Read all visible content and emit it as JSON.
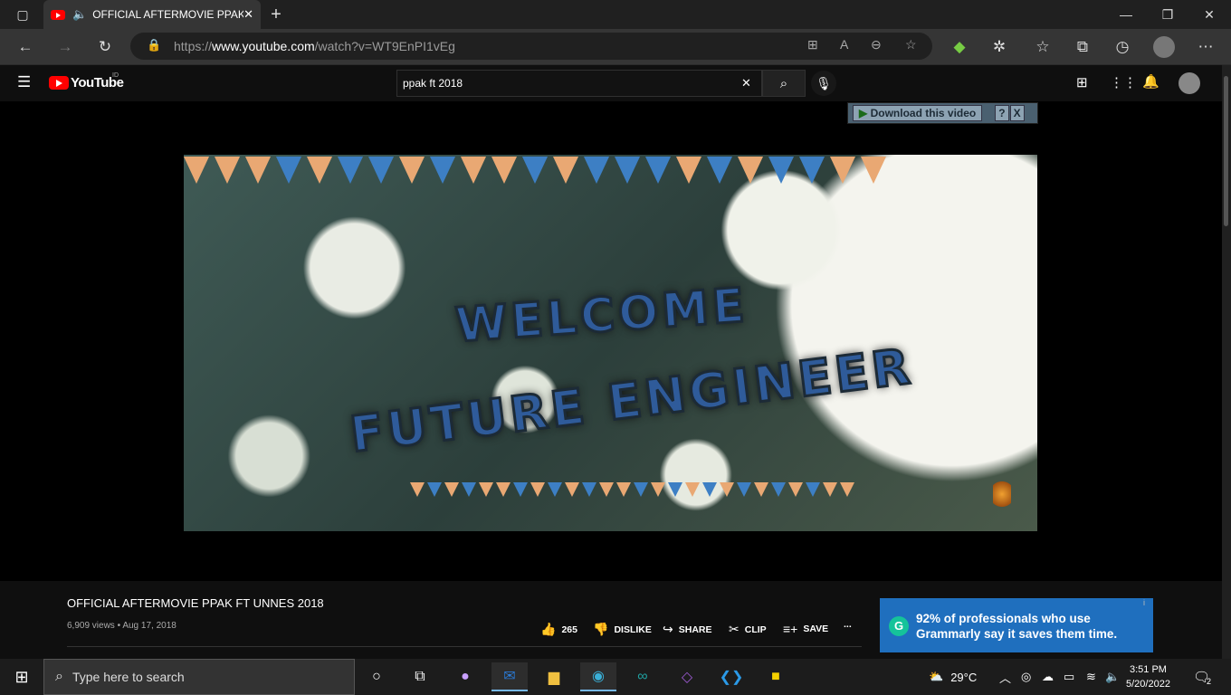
{
  "browser": {
    "tab_title": "OFFICIAL AFTERMOVIE PPAK",
    "url_prefix": "https://",
    "url_host": "www.youtube.com",
    "url_path": "/watch?v=WT9EnPI1vEg"
  },
  "youtube": {
    "logo_text": "YouTube",
    "region": "ID",
    "search_value": "ppak ft 2018"
  },
  "extension": {
    "download_label": "Download this video",
    "help": "?",
    "close": "X"
  },
  "video_frame": {
    "line1": "WELCOME",
    "line2": "FUTURE ENGINEER"
  },
  "video": {
    "title": "OFFICIAL AFTERMOVIE PPAK FT UNNES 2018",
    "meta": "6,909 views • Aug 17, 2018",
    "actions": {
      "likes": "265",
      "dislike": "DISLIKE",
      "share": "SHARE",
      "clip": "CLIP",
      "save": "SAVE",
      "more": "..."
    }
  },
  "ad": {
    "text": "92% of professionals who use Grammarly say it saves them time.",
    "info": "i"
  },
  "taskbar": {
    "search_placeholder": "Type here to search",
    "weather": "29°C",
    "time": "3:51 PM",
    "date": "5/20/2022",
    "notifications": "2"
  },
  "colors": {
    "youtube_red": "#ff0000",
    "ad_blue": "#1f6fbe",
    "bunting_orange": "#e9a873",
    "bunting_blue": "#3d7fc4"
  }
}
